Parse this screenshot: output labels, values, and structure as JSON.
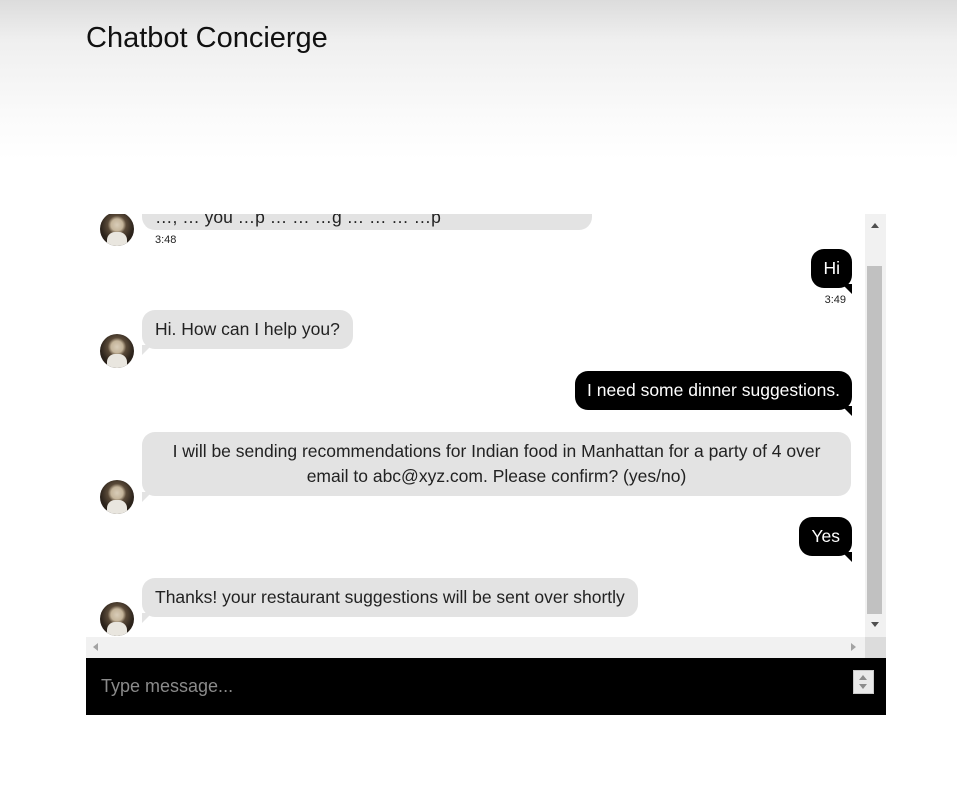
{
  "header": {
    "title": "Chatbot Concierge"
  },
  "messages": [
    {
      "sender": "bot",
      "text": "…, … you …p … … …g … … … …p",
      "time": "3:48"
    },
    {
      "sender": "user",
      "text": "Hi",
      "time": "3:49"
    },
    {
      "sender": "bot",
      "text": "Hi. How can I help you?"
    },
    {
      "sender": "user",
      "text": "I need some dinner suggestions."
    },
    {
      "sender": "bot",
      "text": "I will be sending recommendations for Indian food in Manhattan for a party of 4 over email to abc@xyz.com. Please confirm? (yes/no)"
    },
    {
      "sender": "user",
      "text": "Yes"
    },
    {
      "sender": "bot",
      "text": "Thanks! your restaurant suggestions will be sent over shortly"
    }
  ],
  "composer": {
    "placeholder": "Type message...",
    "value": ""
  }
}
